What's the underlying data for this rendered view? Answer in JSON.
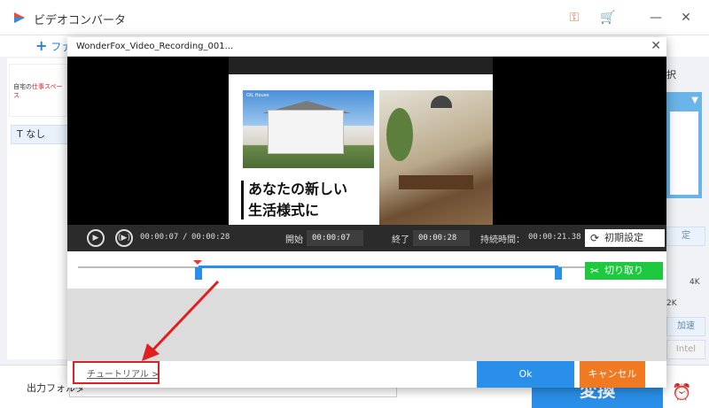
{
  "app": {
    "title": "ビデオコンバータ",
    "add_files_label": "ファ",
    "subtitle_option": "なし",
    "thumbnail_caption_prefix": "自宅の",
    "thumbnail_caption_highlight": "仕事スペース",
    "right_panel": {
      "label": "択",
      "button1": "定",
      "small_4k": "4K",
      "small_2k": "2K",
      "button2": "加速",
      "button3": "Intel"
    },
    "output_label": "出力フォルダ",
    "output_path": "",
    "convert_label": "変換"
  },
  "dialog": {
    "title": "WonderFox_Video_Recording_001...",
    "video_caption": "OIL House",
    "headline_line1": "あなたの新しい",
    "headline_line2": "生活様式に",
    "current_time": "00:00:07",
    "separator": "/",
    "total_time": "00:00:28",
    "start_label": "開始",
    "start_value": "00:00:07",
    "end_label": "終了",
    "end_value": "00:00:28",
    "duration_label": "持続時間：",
    "duration_value": "00:00:21.38",
    "reset_label": "初期設定",
    "cut_label": "切り取り",
    "tutorial_label": "チュートリアル >",
    "ok_label": "Ok",
    "cancel_label": "キャンセル"
  },
  "colors": {
    "accent_blue": "#2a8fe8",
    "cut_green": "#1ec93f",
    "cancel_orange": "#f07a22",
    "highlight_red": "#e02020"
  }
}
